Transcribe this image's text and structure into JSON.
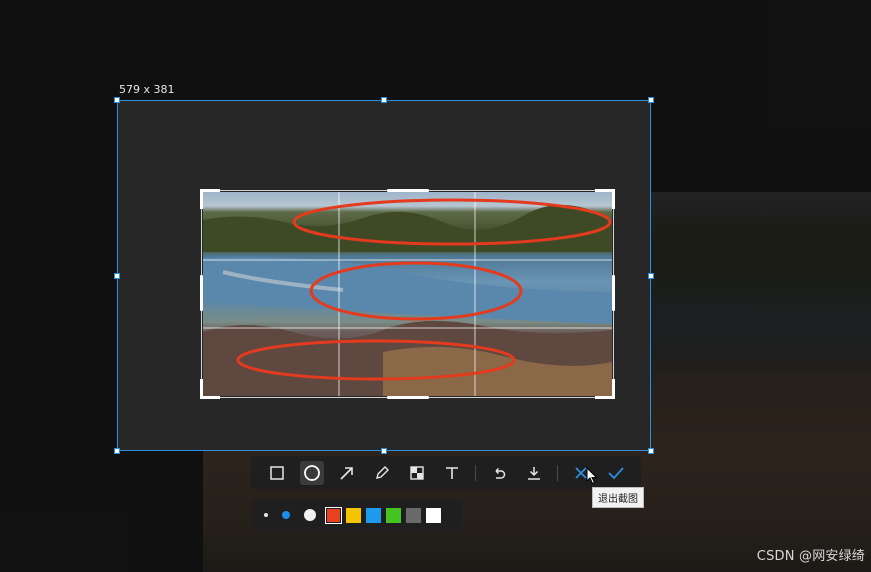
{
  "selection": {
    "size_label": "579 x 381"
  },
  "toolbar": {
    "tools": [
      {
        "name": "rectangle-tool",
        "icon": "rectangle-icon",
        "active": false
      },
      {
        "name": "ellipse-tool",
        "icon": "ellipse-icon",
        "active": true
      },
      {
        "name": "arrow-tool",
        "icon": "arrow-icon",
        "active": false
      },
      {
        "name": "pen-tool",
        "icon": "pencil-icon",
        "active": false
      },
      {
        "name": "mosaic-tool",
        "icon": "mosaic-icon",
        "active": false
      },
      {
        "name": "text-tool",
        "icon": "text-icon",
        "active": false
      },
      {
        "name": "undo-button",
        "icon": "undo-icon"
      },
      {
        "name": "save-button",
        "icon": "download-icon"
      },
      {
        "name": "exit-button",
        "icon": "close-icon"
      },
      {
        "name": "confirm-button",
        "icon": "check-icon"
      }
    ]
  },
  "palette": {
    "sizes": [
      "small",
      "medium",
      "large"
    ],
    "selected_size": "medium",
    "colors": [
      "#e8411f",
      "#f5c400",
      "#1e9bef",
      "#44c421",
      "#6a6a6a",
      "#ffffff"
    ],
    "selected_color": "#e8411f"
  },
  "accent_color": "#2b8fe0",
  "annotation_color": "#e43a1e",
  "tooltip": {
    "text": "退出截图"
  },
  "watermark": {
    "text": "CSDN @网安绿绮"
  }
}
